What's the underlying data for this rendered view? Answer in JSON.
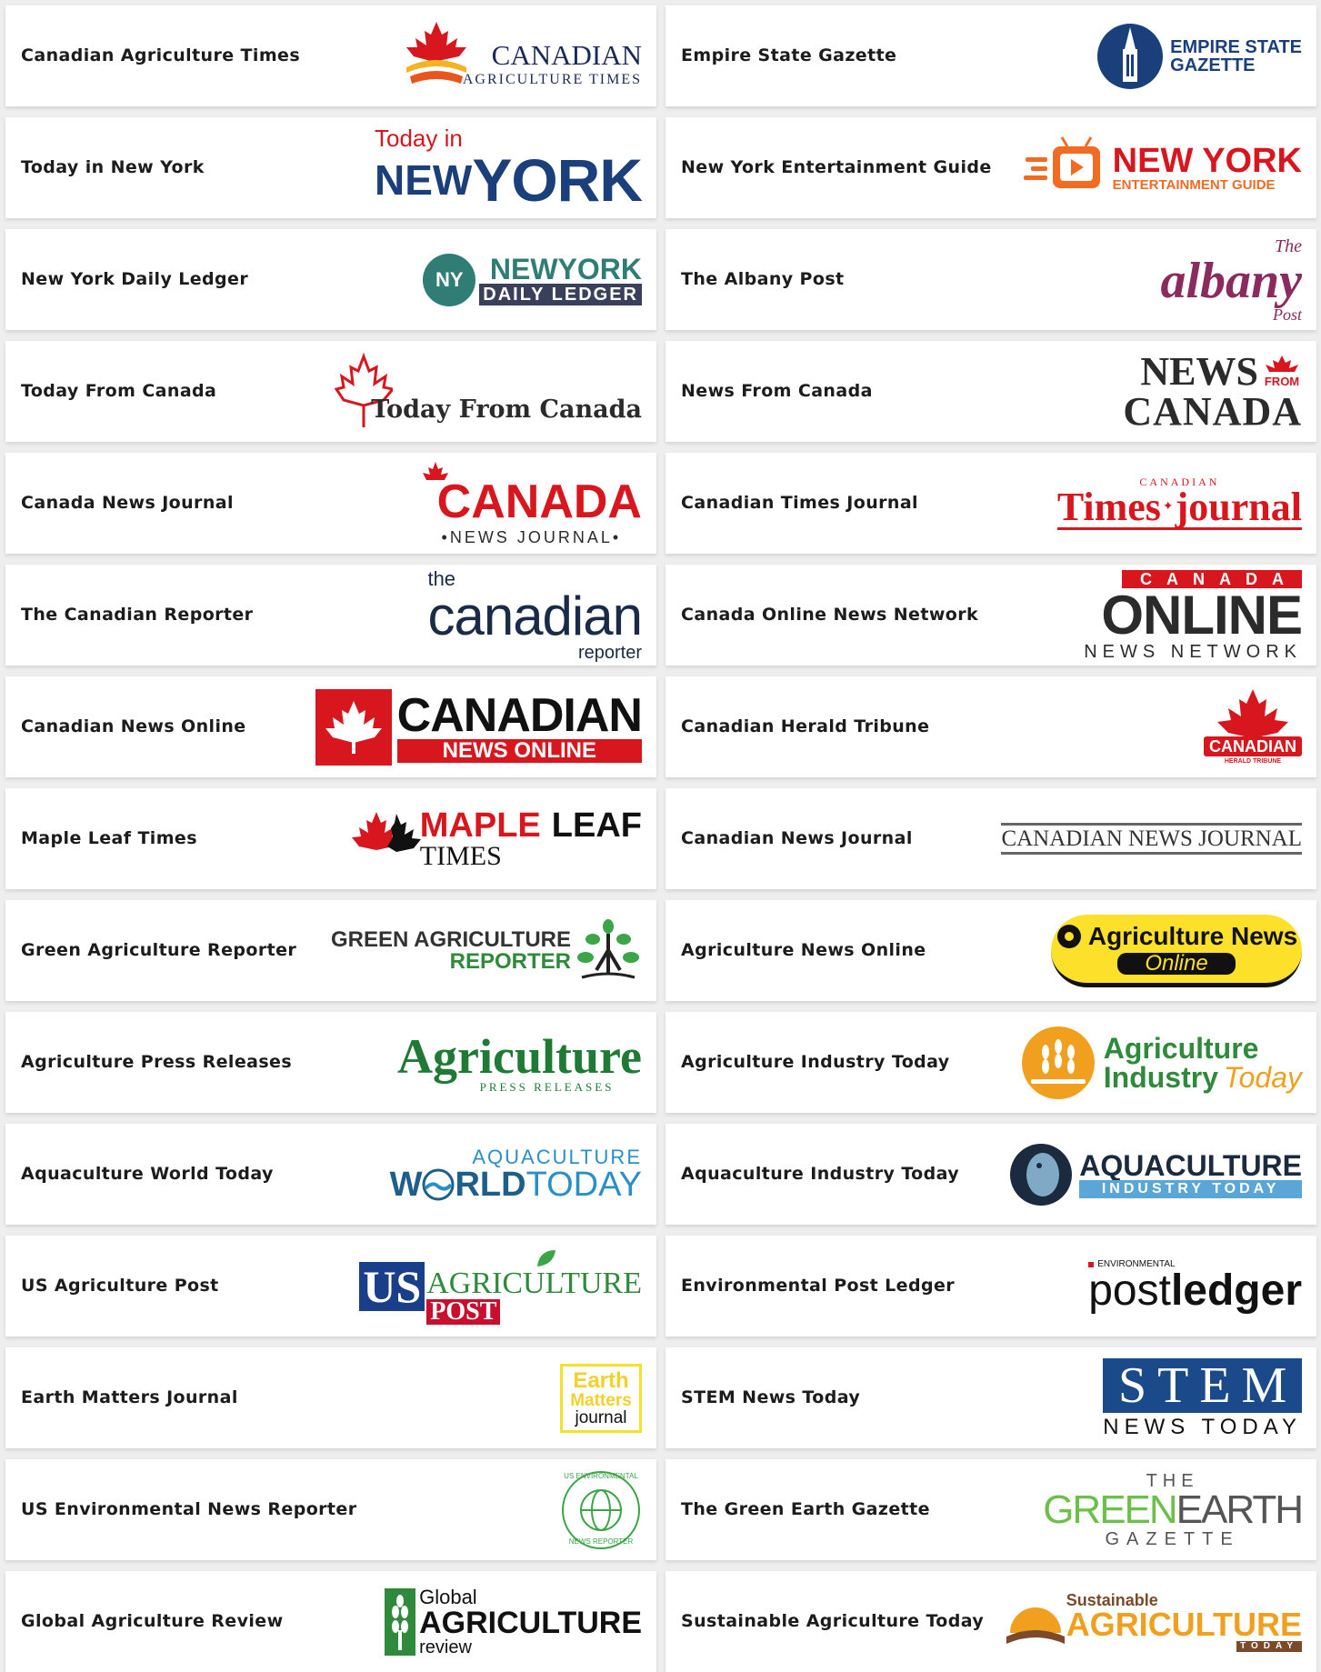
{
  "colors": {
    "red": "#d7161e",
    "navy": "#1a2b57",
    "green": "#2f8a3b",
    "orange": "#f26b22",
    "teal": "#2f7d74"
  },
  "cards": [
    {
      "name": "Canadian Agriculture Times",
      "logo": {
        "line1": "CANADIAN",
        "line2": "AGRICULTURE TIMES"
      }
    },
    {
      "name": "Empire State Gazette",
      "logo": {
        "line1": "EMPIRE STATE",
        "line2": "GAZETTE"
      }
    },
    {
      "name": "Today in New York",
      "logo": {
        "line1": "Today in",
        "line2": "NEW",
        "line3": "YORK"
      }
    },
    {
      "name": "New York Entertainment Guide",
      "logo": {
        "line1": "NEW YORK",
        "line2": "ENTERTAINMENT GUIDE"
      }
    },
    {
      "name": "New York Daily Ledger",
      "logo": {
        "badge": "NY",
        "line1": "NEWYORK",
        "line2": "DAILY LEDGER"
      }
    },
    {
      "name": "The Albany Post",
      "logo": {
        "line1": "The",
        "line2": "albany",
        "line3": "Post"
      }
    },
    {
      "name": "Today From Canada",
      "logo": {
        "line1": "Today From Canada"
      }
    },
    {
      "name": "News From Canada",
      "logo": {
        "line1": "NEWS",
        "line2": "FROM",
        "line3": "CANADA"
      }
    },
    {
      "name": "Canada News Journal",
      "logo": {
        "line1": "CANADA",
        "line2": "•NEWS JOURNAL•"
      }
    },
    {
      "name": "Canadian Times Journal",
      "logo": {
        "line1": "CANADIAN",
        "line2": "Times",
        "line3": "journal"
      }
    },
    {
      "name": "The Canadian Reporter",
      "logo": {
        "line1": "the",
        "line2": "canadian",
        "line3": "reporter"
      }
    },
    {
      "name": "Canada Online News Network",
      "logo": {
        "line1": "CANADA",
        "line2": "ONLINE",
        "line3": "NEWS NETWORK"
      }
    },
    {
      "name": "Canadian News Online",
      "logo": {
        "line1": "CANADIAN",
        "line2": "NEWS ONLINE"
      }
    },
    {
      "name": "Canadian Herald Tribune",
      "logo": {
        "line1": "CANADIAN",
        "line2": "HERALD TRIBUNE"
      }
    },
    {
      "name": "Maple Leaf Times",
      "logo": {
        "line1": "MAPLE",
        "line2": "LEAF",
        "line3": "TIMES"
      }
    },
    {
      "name": "Canadian News Journal",
      "logo": {
        "line1": "CANADIAN NEWS JOURNAL"
      }
    },
    {
      "name": "Green Agriculture Reporter",
      "logo": {
        "line1": "GREEN AGRICULTURE",
        "line2": "REPORTER"
      }
    },
    {
      "name": "Agriculture News Online",
      "logo": {
        "line1": "Agriculture News",
        "line2": "Online"
      }
    },
    {
      "name": "Agriculture Press Releases",
      "logo": {
        "line1": "Agriculture",
        "line2": "PRESS RELEASES"
      }
    },
    {
      "name": "Agriculture Industry Today",
      "logo": {
        "line1": "Agriculture",
        "line2": "Industry",
        "line3": "Today"
      }
    },
    {
      "name": "Aquaculture World Today",
      "logo": {
        "line1": "AQUACULTURE",
        "line2": "W",
        "line3": "RLD",
        "line4": "TODAY"
      }
    },
    {
      "name": "Aquaculture Industry Today",
      "logo": {
        "line1": "AQUACULTURE",
        "line2": "INDUSTRY TODAY"
      }
    },
    {
      "name": "US Agriculture Post",
      "logo": {
        "line1": "US",
        "line2": "AGRICULTURE",
        "line3": "POST"
      }
    },
    {
      "name": "Environmental Post Ledger",
      "logo": {
        "line1": "ENVIRONMENTAL",
        "line2": "post",
        "line3": "ledger"
      }
    },
    {
      "name": "Earth Matters Journal",
      "logo": {
        "line1": "Earth",
        "line2": "Matters",
        "line3": "journal"
      }
    },
    {
      "name": "STEM News Today",
      "logo": {
        "line1": "STEM",
        "line2": "NEWS TODAY"
      }
    },
    {
      "name": "US Environmental News Reporter",
      "logo": {
        "line1": "US ENVIRONMENTAL",
        "line2": "NEWS REPORTER"
      }
    },
    {
      "name": "The Green Earth Gazette",
      "logo": {
        "line1": "THE",
        "line2": "GREEN",
        "line3": "EARTH",
        "line4": "GAZETTE"
      }
    },
    {
      "name": "Global Agriculture Review",
      "logo": {
        "line1": "Global",
        "line2": "AGRICULTURE",
        "line3": "review"
      }
    },
    {
      "name": "Sustainable Agriculture Today",
      "logo": {
        "line1": "Sustainable",
        "line2": "AGRICULTURE",
        "line3": "TODAY"
      }
    }
  ]
}
